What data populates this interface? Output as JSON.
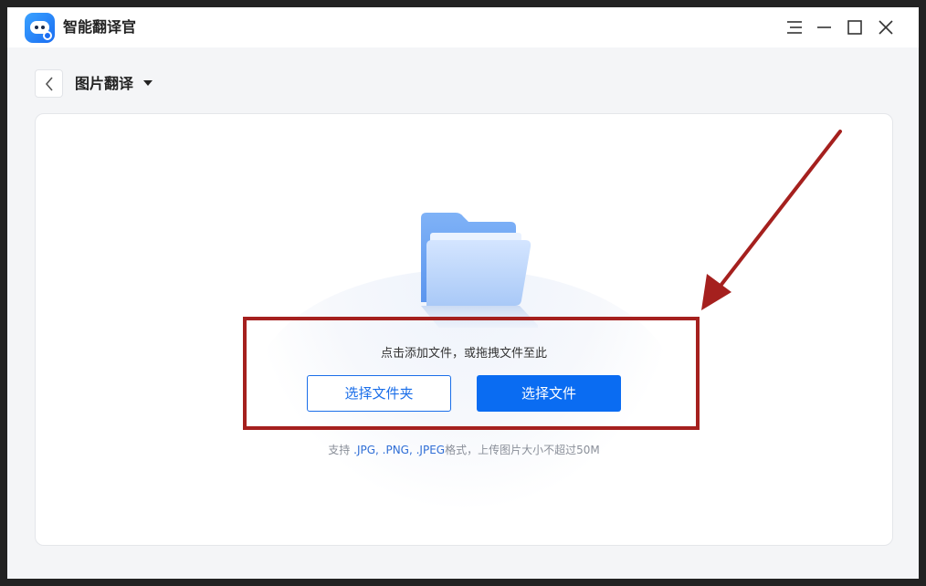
{
  "app": {
    "title": "智能翻译官",
    "icon": "robot-logo-icon",
    "controls": [
      "menu-icon",
      "minimize-icon",
      "maximize-icon",
      "close-icon"
    ]
  },
  "header": {
    "back_icon": "chevron-left-icon",
    "mode_label": "图片翻译",
    "dropdown_icon": "caret-down-icon"
  },
  "upload": {
    "hint": "点击添加文件，或拖拽文件至此",
    "select_folder_label": "选择文件夹",
    "select_file_label": "选择文件",
    "support_prefix": "支持 ",
    "support_formats": ".JPG, .PNG, .JPEG",
    "support_suffix": "格式，上传图片大小不超过50M",
    "illustration_icon": "folder-icon"
  },
  "colors": {
    "primary": "#0a6cf2",
    "annotation": "#a5201e",
    "background": "#f4f5f7"
  }
}
